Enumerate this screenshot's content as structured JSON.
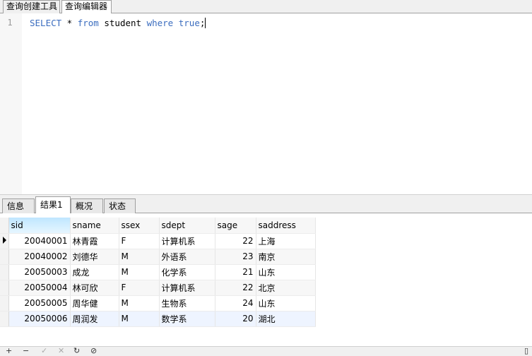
{
  "top_tabs": [
    {
      "label": "查询创建工具"
    },
    {
      "label": "查询编辑器"
    }
  ],
  "editor": {
    "line_number": "1",
    "tokens": {
      "select": "SELECT",
      "star": " * ",
      "from": "from",
      "table": " student ",
      "where": "where",
      "sp": " ",
      "true": "true",
      "semi": ";"
    }
  },
  "result_tabs": [
    {
      "label": "信息"
    },
    {
      "label": "结果1"
    },
    {
      "label": "概况"
    },
    {
      "label": "状态"
    }
  ],
  "grid": {
    "columns": [
      "sid",
      "sname",
      "ssex",
      "sdept",
      "sage",
      "saddress"
    ],
    "rows": [
      {
        "sid": "20040001",
        "sname": "林青霞",
        "ssex": "F",
        "sdept": "计算机系",
        "sage": "22",
        "saddress": "上海"
      },
      {
        "sid": "20040002",
        "sname": "刘德华",
        "ssex": "M",
        "sdept": "外语系",
        "sage": "23",
        "saddress": "南京"
      },
      {
        "sid": "20050003",
        "sname": "成龙",
        "ssex": "M",
        "sdept": "化学系",
        "sage": "21",
        "saddress": "山东"
      },
      {
        "sid": "20050004",
        "sname": "林可欣",
        "ssex": "F",
        "sdept": "计算机系",
        "sage": "22",
        "saddress": "北京"
      },
      {
        "sid": "20050005",
        "sname": "周华健",
        "ssex": "M",
        "sdept": "生物系",
        "sage": "24",
        "saddress": "山东"
      },
      {
        "sid": "20050006",
        "sname": "周润发",
        "ssex": "M",
        "sdept": "数学系",
        "sage": "20",
        "saddress": "湖北"
      }
    ]
  },
  "bottom_toolbar": {
    "icons": [
      "add-record-icon",
      "delete-record-icon",
      "apply-icon",
      "cancel-icon",
      "refresh-icon",
      "stop-icon"
    ]
  },
  "colors": {
    "keyword": "#3b6dbf",
    "selected_header": "#bfe6ff"
  }
}
